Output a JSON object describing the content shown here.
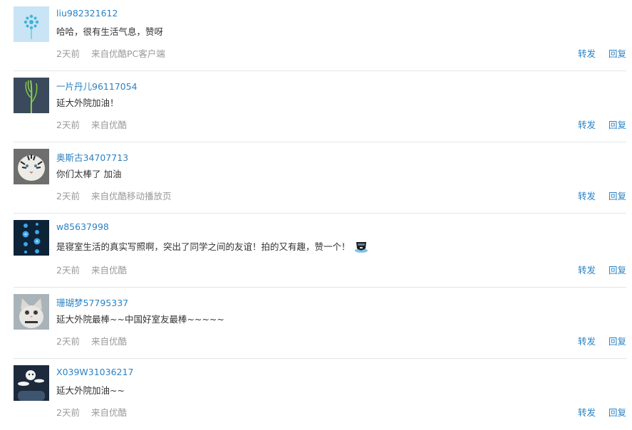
{
  "comments": [
    {
      "avatar_icon": "dandelion-avatar-icon",
      "username": "liu982321612",
      "text": "哈哈，很有生活气息，赞呀",
      "time": "2天前",
      "source": "来自优酷PC客户端",
      "forward_label": "转发",
      "reply_label": "回复"
    },
    {
      "avatar_icon": "plant-stem-avatar-icon",
      "username": "一片丹儿96117054",
      "text": "延大外院加油！",
      "time": "2天前",
      "source": "来自优酷",
      "forward_label": "转发",
      "reply_label": "回复"
    },
    {
      "avatar_icon": "white-tiger-avatar-icon",
      "username": "奥斯古34707713",
      "text": "你们太棒了 加油",
      "time": "2天前",
      "source": "来自优酷移动播放页",
      "forward_label": "转发",
      "reply_label": "回复"
    },
    {
      "avatar_icon": "blue-dots-avatar-icon",
      "username": "w85637998",
      "text": "是寝室生活的真实写照啊，突出了同学之间的友谊！拍的又有趣，赞一个！",
      "emoji_icon": "cool-face-emoji-icon",
      "time": "2天前",
      "source": "来自优酷",
      "forward_label": "转发",
      "reply_label": "回复"
    },
    {
      "avatar_icon": "cat-avatar-icon",
      "username": "珊瑚梦57795337",
      "text": "延大外院最棒~~中国好室友最棒~~~~~",
      "time": "2天前",
      "source": "来自优酷",
      "forward_label": "转发",
      "reply_label": "回复"
    },
    {
      "avatar_icon": "moon-cloud-avatar-icon",
      "username": "X039W31036217",
      "text": "延大外院加油~~",
      "time": "2天前",
      "source": "来自优酷",
      "forward_label": "转发",
      "reply_label": "回复"
    }
  ]
}
